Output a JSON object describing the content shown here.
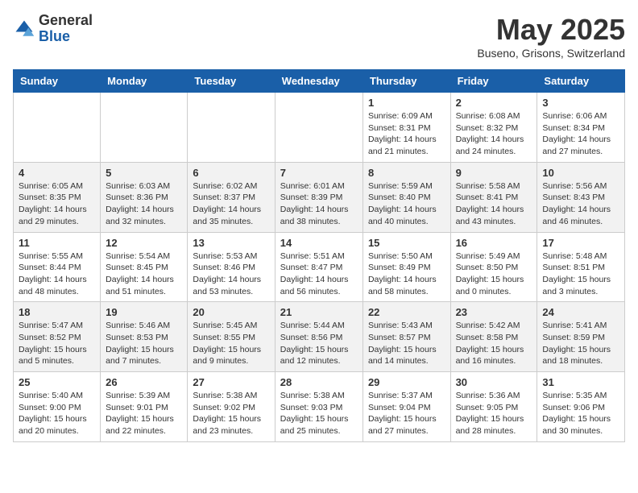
{
  "logo": {
    "general": "General",
    "blue": "Blue"
  },
  "title": "May 2025",
  "location": "Buseno, Grisons, Switzerland",
  "days_of_week": [
    "Sunday",
    "Monday",
    "Tuesday",
    "Wednesday",
    "Thursday",
    "Friday",
    "Saturday"
  ],
  "weeks": [
    [
      {
        "day": "",
        "info": ""
      },
      {
        "day": "",
        "info": ""
      },
      {
        "day": "",
        "info": ""
      },
      {
        "day": "",
        "info": ""
      },
      {
        "day": "1",
        "info": "Sunrise: 6:09 AM\nSunset: 8:31 PM\nDaylight: 14 hours\nand 21 minutes."
      },
      {
        "day": "2",
        "info": "Sunrise: 6:08 AM\nSunset: 8:32 PM\nDaylight: 14 hours\nand 24 minutes."
      },
      {
        "day": "3",
        "info": "Sunrise: 6:06 AM\nSunset: 8:34 PM\nDaylight: 14 hours\nand 27 minutes."
      }
    ],
    [
      {
        "day": "4",
        "info": "Sunrise: 6:05 AM\nSunset: 8:35 PM\nDaylight: 14 hours\nand 29 minutes."
      },
      {
        "day": "5",
        "info": "Sunrise: 6:03 AM\nSunset: 8:36 PM\nDaylight: 14 hours\nand 32 minutes."
      },
      {
        "day": "6",
        "info": "Sunrise: 6:02 AM\nSunset: 8:37 PM\nDaylight: 14 hours\nand 35 minutes."
      },
      {
        "day": "7",
        "info": "Sunrise: 6:01 AM\nSunset: 8:39 PM\nDaylight: 14 hours\nand 38 minutes."
      },
      {
        "day": "8",
        "info": "Sunrise: 5:59 AM\nSunset: 8:40 PM\nDaylight: 14 hours\nand 40 minutes."
      },
      {
        "day": "9",
        "info": "Sunrise: 5:58 AM\nSunset: 8:41 PM\nDaylight: 14 hours\nand 43 minutes."
      },
      {
        "day": "10",
        "info": "Sunrise: 5:56 AM\nSunset: 8:43 PM\nDaylight: 14 hours\nand 46 minutes."
      }
    ],
    [
      {
        "day": "11",
        "info": "Sunrise: 5:55 AM\nSunset: 8:44 PM\nDaylight: 14 hours\nand 48 minutes."
      },
      {
        "day": "12",
        "info": "Sunrise: 5:54 AM\nSunset: 8:45 PM\nDaylight: 14 hours\nand 51 minutes."
      },
      {
        "day": "13",
        "info": "Sunrise: 5:53 AM\nSunset: 8:46 PM\nDaylight: 14 hours\nand 53 minutes."
      },
      {
        "day": "14",
        "info": "Sunrise: 5:51 AM\nSunset: 8:47 PM\nDaylight: 14 hours\nand 56 minutes."
      },
      {
        "day": "15",
        "info": "Sunrise: 5:50 AM\nSunset: 8:49 PM\nDaylight: 14 hours\nand 58 minutes."
      },
      {
        "day": "16",
        "info": "Sunrise: 5:49 AM\nSunset: 8:50 PM\nDaylight: 15 hours\nand 0 minutes."
      },
      {
        "day": "17",
        "info": "Sunrise: 5:48 AM\nSunset: 8:51 PM\nDaylight: 15 hours\nand 3 minutes."
      }
    ],
    [
      {
        "day": "18",
        "info": "Sunrise: 5:47 AM\nSunset: 8:52 PM\nDaylight: 15 hours\nand 5 minutes."
      },
      {
        "day": "19",
        "info": "Sunrise: 5:46 AM\nSunset: 8:53 PM\nDaylight: 15 hours\nand 7 minutes."
      },
      {
        "day": "20",
        "info": "Sunrise: 5:45 AM\nSunset: 8:55 PM\nDaylight: 15 hours\nand 9 minutes."
      },
      {
        "day": "21",
        "info": "Sunrise: 5:44 AM\nSunset: 8:56 PM\nDaylight: 15 hours\nand 12 minutes."
      },
      {
        "day": "22",
        "info": "Sunrise: 5:43 AM\nSunset: 8:57 PM\nDaylight: 15 hours\nand 14 minutes."
      },
      {
        "day": "23",
        "info": "Sunrise: 5:42 AM\nSunset: 8:58 PM\nDaylight: 15 hours\nand 16 minutes."
      },
      {
        "day": "24",
        "info": "Sunrise: 5:41 AM\nSunset: 8:59 PM\nDaylight: 15 hours\nand 18 minutes."
      }
    ],
    [
      {
        "day": "25",
        "info": "Sunrise: 5:40 AM\nSunset: 9:00 PM\nDaylight: 15 hours\nand 20 minutes."
      },
      {
        "day": "26",
        "info": "Sunrise: 5:39 AM\nSunset: 9:01 PM\nDaylight: 15 hours\nand 22 minutes."
      },
      {
        "day": "27",
        "info": "Sunrise: 5:38 AM\nSunset: 9:02 PM\nDaylight: 15 hours\nand 23 minutes."
      },
      {
        "day": "28",
        "info": "Sunrise: 5:38 AM\nSunset: 9:03 PM\nDaylight: 15 hours\nand 25 minutes."
      },
      {
        "day": "29",
        "info": "Sunrise: 5:37 AM\nSunset: 9:04 PM\nDaylight: 15 hours\nand 27 minutes."
      },
      {
        "day": "30",
        "info": "Sunrise: 5:36 AM\nSunset: 9:05 PM\nDaylight: 15 hours\nand 28 minutes."
      },
      {
        "day": "31",
        "info": "Sunrise: 5:35 AM\nSunset: 9:06 PM\nDaylight: 15 hours\nand 30 minutes."
      }
    ]
  ]
}
